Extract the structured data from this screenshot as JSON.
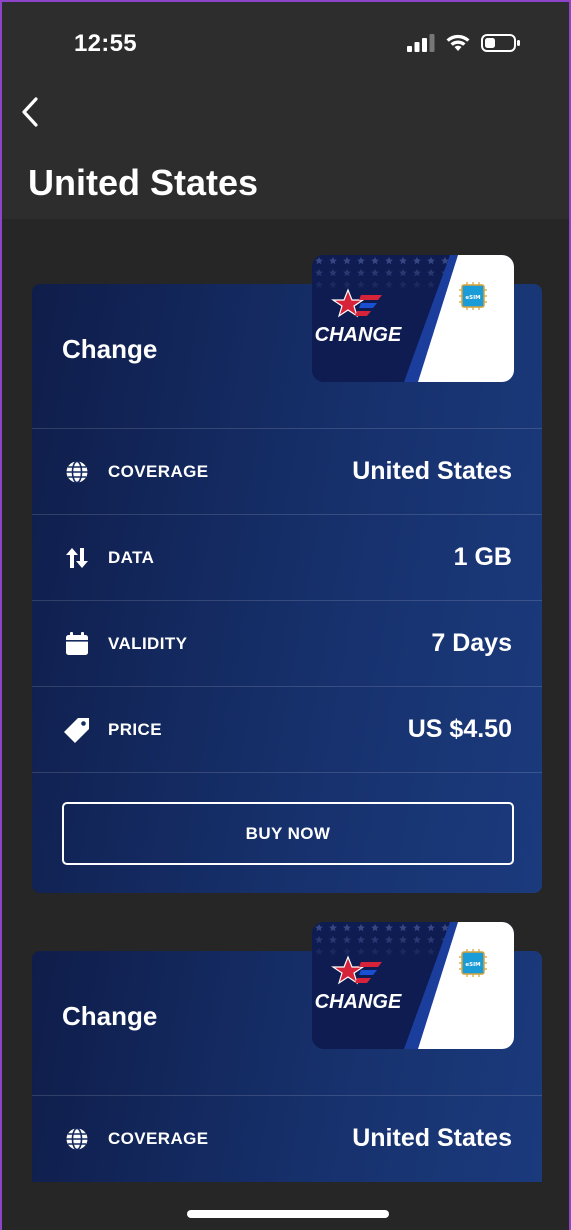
{
  "status_bar": {
    "time": "12:55"
  },
  "header": {
    "title": "United States"
  },
  "plans": [
    {
      "name": "Change",
      "brand_text": "CHANGE",
      "chip_text": "eSIM",
      "rows": [
        {
          "icon": "globe-icon",
          "label": "COVERAGE",
          "value": "United States"
        },
        {
          "icon": "data-transfer-icon",
          "label": "DATA",
          "value": "1 GB"
        },
        {
          "icon": "calendar-icon",
          "label": "VALIDITY",
          "value": "7 Days"
        },
        {
          "icon": "price-tag-icon",
          "label": "PRICE",
          "value": "US $4.50"
        }
      ],
      "button_label": "BUY NOW"
    },
    {
      "name": "Change",
      "brand_text": "CHANGE",
      "chip_text": "eSIM",
      "rows": [
        {
          "icon": "globe-icon",
          "label": "COVERAGE",
          "value": "United States"
        }
      ]
    }
  ],
  "colors": {
    "background": "#262626",
    "header": "#2d2d2d",
    "card_dark": "#0f1d4a",
    "card_light": "#1b3a7d",
    "brand_red": "#d6233a",
    "chip_blue": "#1a9cd8"
  }
}
